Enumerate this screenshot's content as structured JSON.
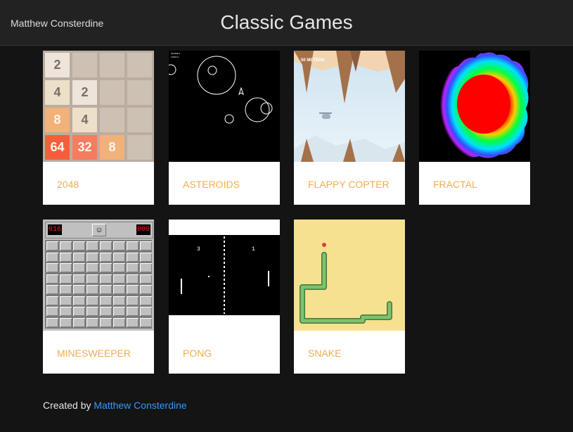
{
  "header": {
    "author": "Matthew Consterdine",
    "title": "Classic Games"
  },
  "games": [
    {
      "label": "2048"
    },
    {
      "label": "ASTEROIDS"
    },
    {
      "label": "FLAPPY COPTER"
    },
    {
      "label": "FRACTAL"
    },
    {
      "label": "MINESWEEPER"
    },
    {
      "label": "PONG"
    },
    {
      "label": "SNAKE"
    }
  ],
  "thumbs": {
    "g2048": {
      "tiles": [
        "2",
        "4",
        "2",
        "8",
        "4",
        "64",
        "32",
        "8"
      ]
    },
    "asteroids": {
      "score": "SCORE 0",
      "lives": "LIVES 3"
    },
    "flappy": {
      "meters": "50 METERS"
    },
    "minesweeper": {
      "left_counter": "016",
      "right_counter": "000"
    },
    "pong": {
      "left_score": "3",
      "right_score": "1"
    }
  },
  "footer": {
    "prefix": "Created by",
    "link": "Matthew Consterdine"
  },
  "colors": {
    "background": "#141414",
    "header": "#222222",
    "accent": "#f0ad4e",
    "link": "#3399ff"
  }
}
